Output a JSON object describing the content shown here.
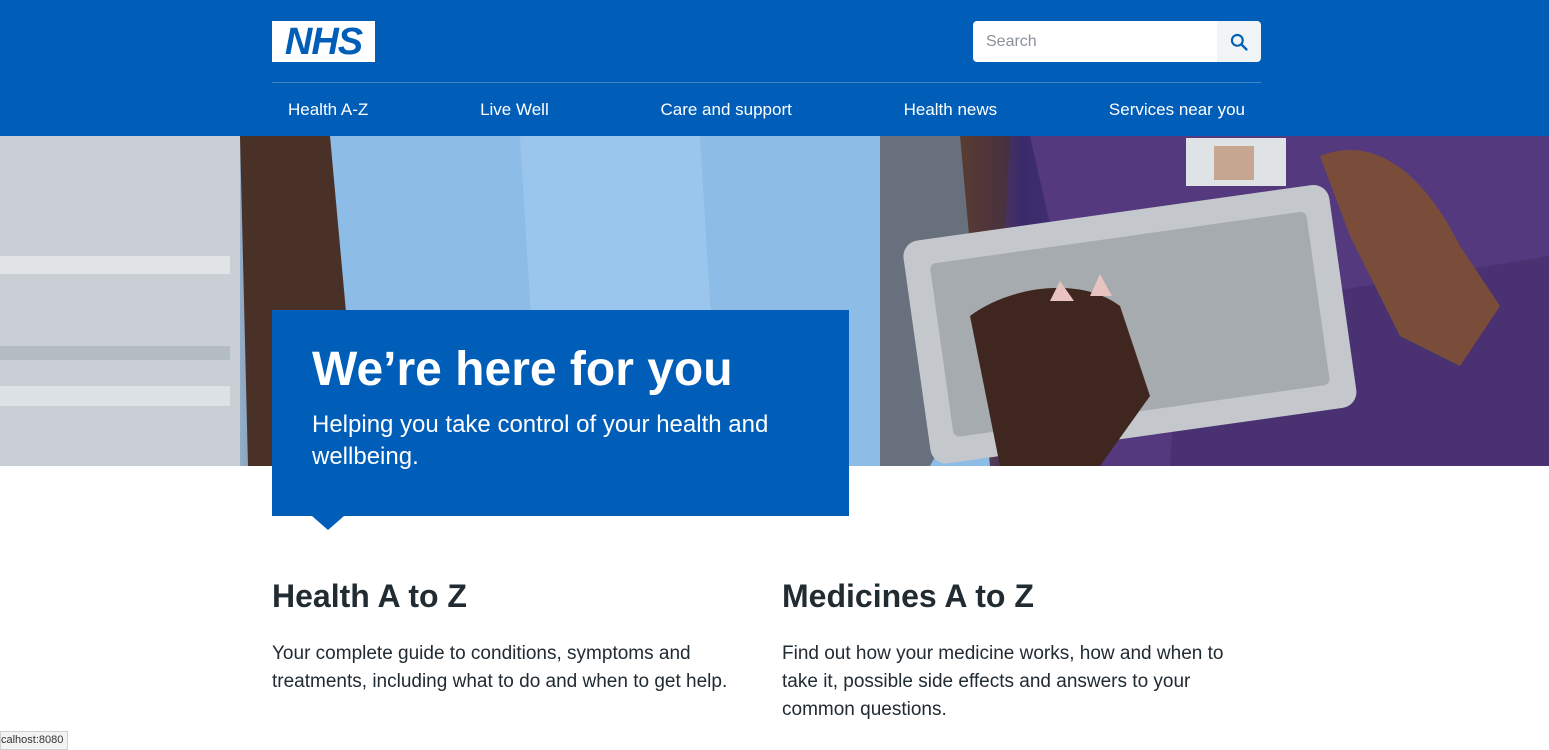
{
  "header": {
    "logo_text": "NHS",
    "search": {
      "placeholder": "Search",
      "value": "",
      "icon": "search-icon"
    },
    "nav": [
      {
        "label": "Health A-Z"
      },
      {
        "label": "Live Well"
      },
      {
        "label": "Care and support"
      },
      {
        "label": "Health news"
      },
      {
        "label": "Services near you"
      }
    ]
  },
  "hero": {
    "title": "We’re here for you",
    "subtitle": "Helping you take control of your health and wellbeing."
  },
  "sections": [
    {
      "title": "Health A to Z",
      "text": "Your complete guide to conditions, symptoms and treatments, including what to do and when to get help."
    },
    {
      "title": "Medicines A to Z",
      "text": "Find out how your medicine works, how and when to take it, possible side effects and answers to your common questions."
    }
  ],
  "status_bar": {
    "text": "calhost:8080"
  },
  "colors": {
    "brand": "#005eb8",
    "text": "#212b32",
    "search_button": "#f0f4f5"
  }
}
